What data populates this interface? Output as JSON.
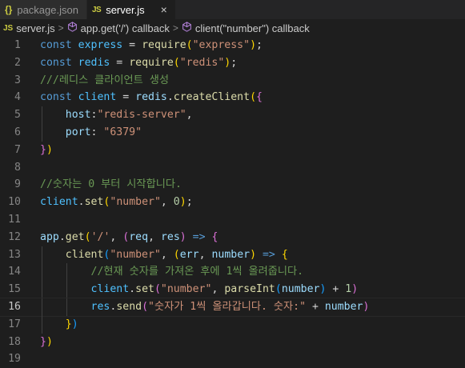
{
  "tabs": [
    {
      "icon": "{}",
      "label": "package.json",
      "active": false
    },
    {
      "icon": "JS",
      "label": "server.js",
      "active": true,
      "close": "×"
    }
  ],
  "breadcrumb": {
    "file_icon": "JS",
    "file": "server.js",
    "sep": ">",
    "item1": "app.get('/') callback",
    "item2": "client(\"number\") callback"
  },
  "code": {
    "line_numbers": [
      "1",
      "2",
      "3",
      "4",
      "5",
      "6",
      "7",
      "8",
      "9",
      "10",
      "11",
      "12",
      "13",
      "14",
      "15",
      "16",
      "17",
      "18",
      "19"
    ],
    "l1": {
      "t1": "const",
      "t2": "express",
      "t3": " = ",
      "t4": "require",
      "t5": "(",
      "t6": "\"express\"",
      "t7": ")",
      "t8": ";"
    },
    "l2": {
      "t1": "const",
      "t2": "redis",
      "t3": " = ",
      "t4": "require",
      "t5": "(",
      "t6": "\"redis\"",
      "t7": ")",
      "t8": ";"
    },
    "l3": {
      "t1": "///레디스 클라이언트 생성"
    },
    "l4": {
      "t1": "const",
      "t2": "client",
      "t3": " = ",
      "t4": "redis",
      "t5": ".",
      "t6": "createClient",
      "t7": "(",
      "t8": "{"
    },
    "l5": {
      "t1": "host",
      "t2": ":",
      "t3": "\"redis-server\"",
      "t4": ","
    },
    "l6": {
      "t1": "port",
      "t2": ": ",
      "t3": "\"6379\""
    },
    "l7": {
      "t1": "}",
      "t2": ")"
    },
    "l8": {},
    "l9": {
      "t1": "//숫자는 0 부터 시작합니다."
    },
    "l10": {
      "t1": "client",
      "t2": ".",
      "t3": "set",
      "t4": "(",
      "t5": "\"number\"",
      "t6": ", ",
      "t7": "0",
      "t8": ")",
      "t9": ";"
    },
    "l11": {},
    "l12": {
      "t1": "app",
      "t2": ".",
      "t3": "get",
      "t4": "(",
      "t5": "'/'",
      "t6": ", ",
      "t7": "(",
      "t8": "req",
      "t9": ", ",
      "t10": "res",
      "t11": ")",
      "t12": " => ",
      "t13": "{"
    },
    "l13": {
      "t1": "client",
      "t2": "(",
      "t3": "\"number\"",
      "t4": ", ",
      "t5": "(",
      "t6": "err",
      "t7": ", ",
      "t8": "number",
      "t9": ")",
      "t10": " => ",
      "t11": "{"
    },
    "l14": {
      "t1": "//현재 숫자를 가져온 후에 1씩 올려줍니다."
    },
    "l15": {
      "t1": "client",
      "t2": ".",
      "t3": "set",
      "t4": "(",
      "t5": "\"number\"",
      "t6": ", ",
      "t7": "parseInt",
      "t8": "(",
      "t9": "number",
      "t10": ")",
      "t11": " + ",
      "t12": "1",
      "t13": ")"
    },
    "l16": {
      "t1": "res",
      "t2": ".",
      "t3": "send",
      "t4": "(",
      "t5": "\"숫자가 1씩 올라갑니다. 숫자:\"",
      "t6": " + ",
      "t7": "number",
      "t8": ")"
    },
    "l17": {
      "t1": "}",
      "t2": ")"
    },
    "l18": {
      "t1": "}",
      "t2": ")"
    },
    "l19": {}
  },
  "colors": {
    "background": "#1e1e1e",
    "keyword": "#569cd6",
    "string": "#ce9178",
    "comment": "#6a9955",
    "function": "#dcdcaa",
    "variable": "#4fc1ff",
    "number": "#b5cea8"
  }
}
